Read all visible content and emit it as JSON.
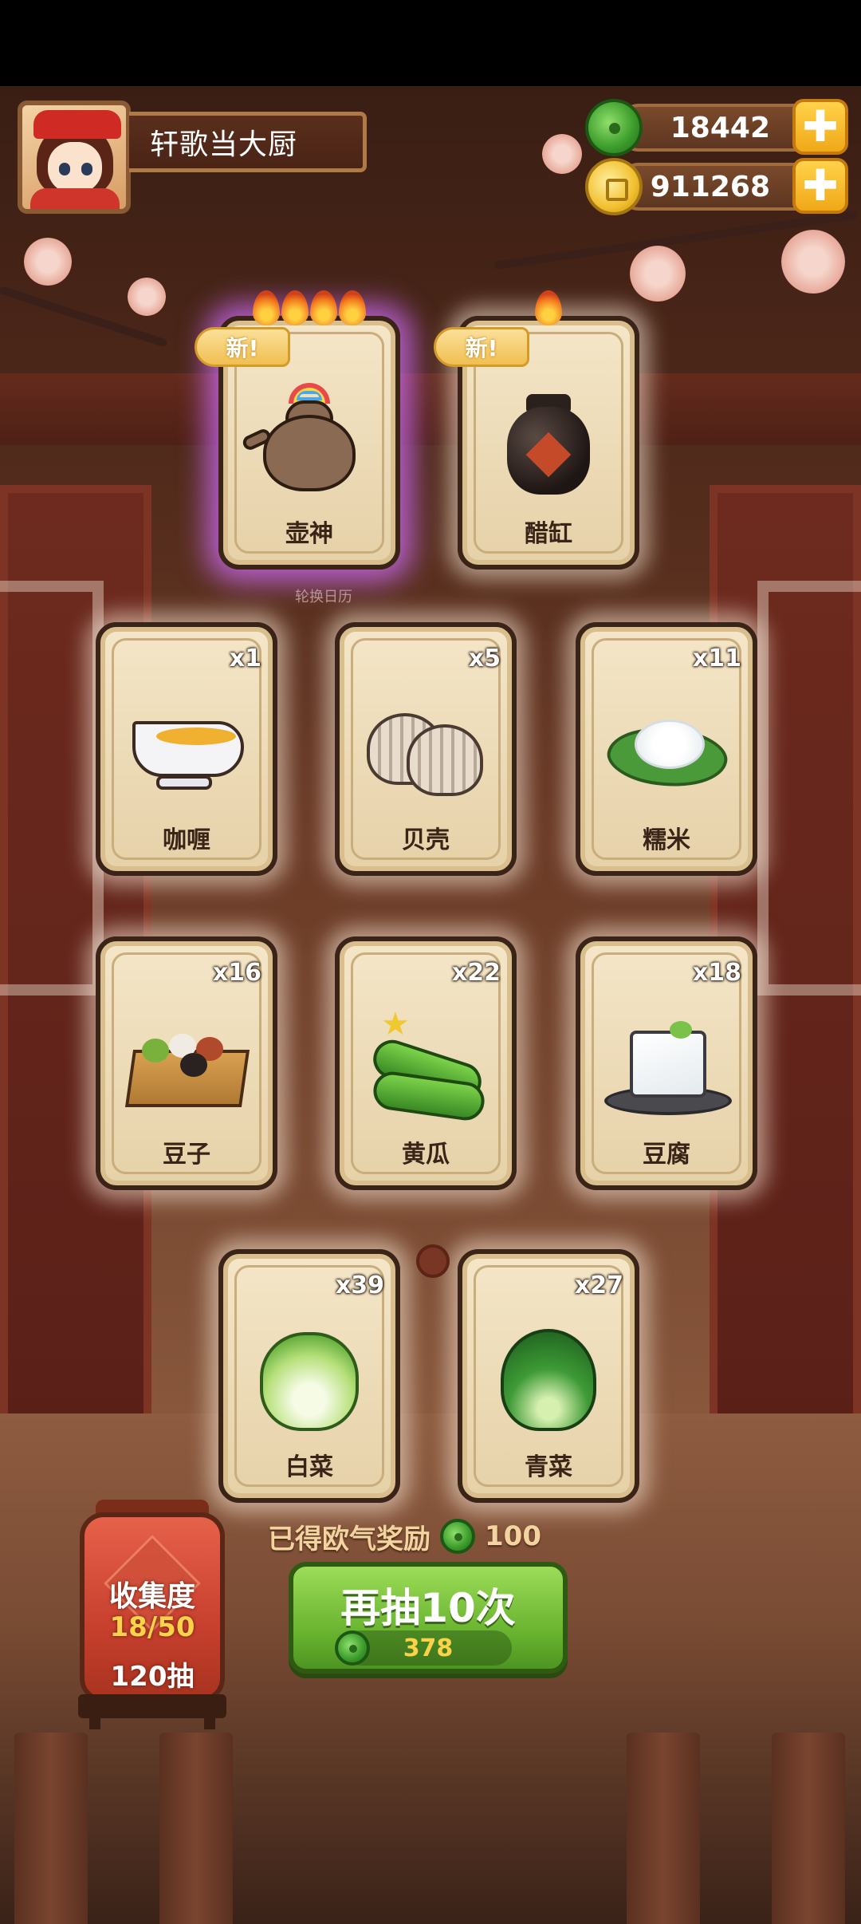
{
  "player": {
    "name": "轩歌当大厨"
  },
  "currency": {
    "jade": {
      "icon": "jade-icon",
      "value": "18442",
      "plus": "✚"
    },
    "coin": {
      "icon": "coin-icon",
      "value": "911268",
      "plus": "✚"
    }
  },
  "background_hint": "轮换日历",
  "cards": [
    {
      "name": "壶神",
      "is_new": true,
      "new_label": "新!",
      "flames": 4,
      "count": "",
      "rarity_glow": "purple",
      "icon": "teapot-icon"
    },
    {
      "name": "醋缸",
      "is_new": true,
      "new_label": "新!",
      "flames": 1,
      "count": "",
      "rarity_glow": "white",
      "icon": "vinegar-jar-icon"
    },
    {
      "name": "咖喱",
      "count": "x1",
      "icon": "curry-icon"
    },
    {
      "name": "贝壳",
      "count": "x5",
      "icon": "shell-icon"
    },
    {
      "name": "糯米",
      "count": "x11",
      "icon": "sticky-rice-icon"
    },
    {
      "name": "豆子",
      "count": "x16",
      "icon": "beans-icon"
    },
    {
      "name": "黄瓜",
      "count": "x22",
      "icon": "cucumber-icon"
    },
    {
      "name": "豆腐",
      "count": "x18",
      "icon": "tofu-icon"
    },
    {
      "name": "白菜",
      "count": "x39",
      "icon": "cabbage-icon"
    },
    {
      "name": "青菜",
      "count": "x27",
      "icon": "bok-choy-icon"
    }
  ],
  "reward": {
    "label": "已得欧气奖励",
    "icon": "jade-icon",
    "value": "100"
  },
  "collection": {
    "title": "收集度",
    "progress": "18/50",
    "pulls": "120抽"
  },
  "draw_button": {
    "label": "再抽10次",
    "cost": "378",
    "cost_icon": "jade-icon"
  },
  "colors": {
    "accent_green": "#64b02c",
    "gold": "#fbd24a",
    "epic_glow": "#d26eff"
  }
}
